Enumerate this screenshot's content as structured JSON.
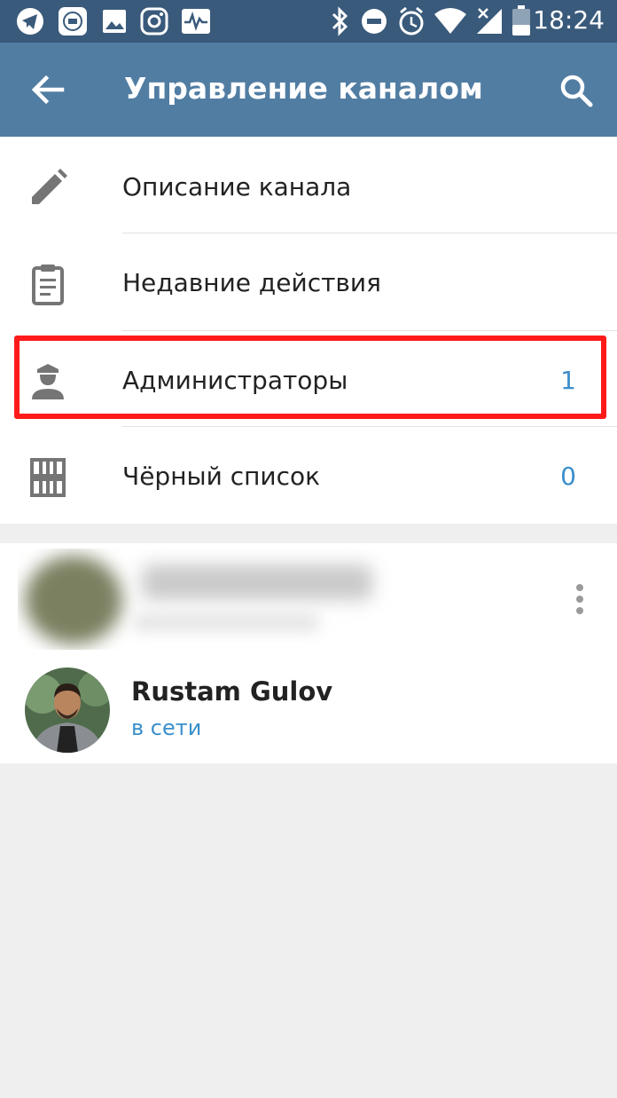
{
  "status_bar": {
    "time": "18:24",
    "left_icons": [
      "telegram-icon",
      "mi-icon",
      "gallery-icon",
      "instagram-icon",
      "activity-icon"
    ],
    "right_icons": [
      "bluetooth-icon",
      "dnd-icon",
      "alarm-icon",
      "wifi-icon",
      "signal-icon",
      "battery-icon"
    ]
  },
  "app_bar": {
    "title": "Управление каналом",
    "back_icon": "arrow-back-icon",
    "search_icon": "search-icon",
    "color": "#527da3"
  },
  "menu": {
    "items": [
      {
        "label": "Описание канала",
        "icon": "pencil-icon",
        "count": ""
      },
      {
        "label": "Недавние действия",
        "icon": "clipboard-icon",
        "count": ""
      },
      {
        "label": "Администраторы",
        "icon": "admin-icon",
        "count": "1"
      },
      {
        "label": "Чёрный список",
        "icon": "blacklist-icon",
        "count": "0"
      }
    ],
    "accent": "#3a8fcc",
    "highlight_color": "#ff1a1a"
  },
  "members": {
    "user": {
      "name": "Rustam Gulov",
      "status": "в сети"
    },
    "more_icon": "more-vertical-icon"
  }
}
